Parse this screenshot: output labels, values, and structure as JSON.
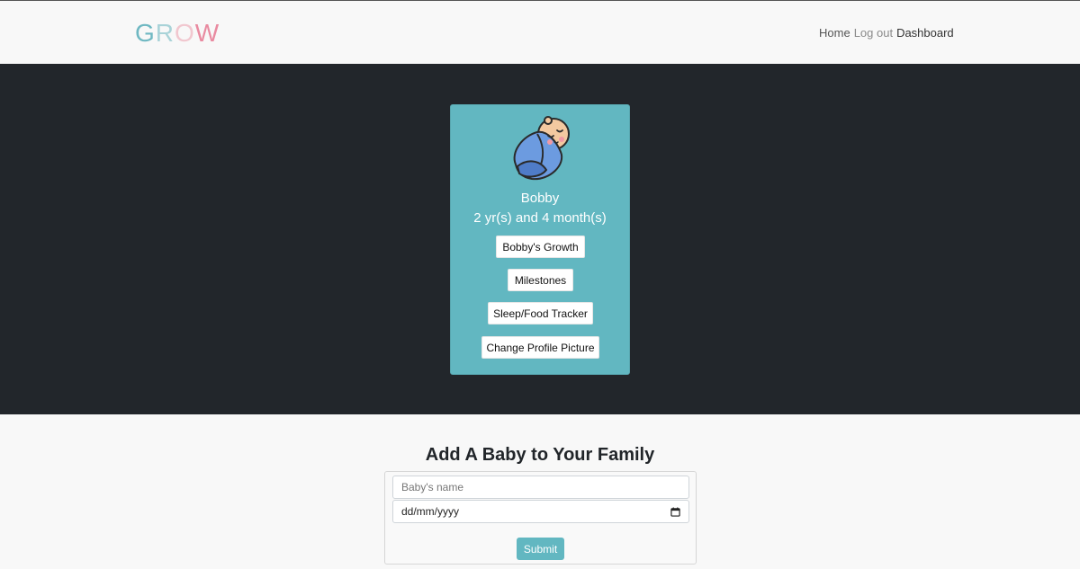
{
  "navbar": {
    "brand_letters": [
      {
        "char": "G",
        "color": "#6fb8c2"
      },
      {
        "char": "R",
        "color": "#a9d3d8"
      },
      {
        "char": "O",
        "color": "#f1c7cf"
      },
      {
        "char": "W",
        "color": "#e98aa0"
      }
    ],
    "links": [
      "Home",
      "Log out",
      "Dashboard"
    ]
  },
  "baby_card": {
    "avatar_icon": "swaddled-baby-icon",
    "name": "Bobby",
    "age": "2 yr(s) and 4 month(s)",
    "buttons": [
      "Bobby's Growth",
      "Milestones",
      "Sleep/Food Tracker",
      "Change Profile Picture"
    ],
    "card_color": "#62b7c1"
  },
  "add_baby_form": {
    "title": "Add A Baby to Your Family",
    "name_placeholder": "Baby's name",
    "date_value": "dd/mm/yyyy",
    "submit_label": "Submit"
  },
  "colors": {
    "hero_bg": "#22262b",
    "accent": "#62b7c1"
  }
}
